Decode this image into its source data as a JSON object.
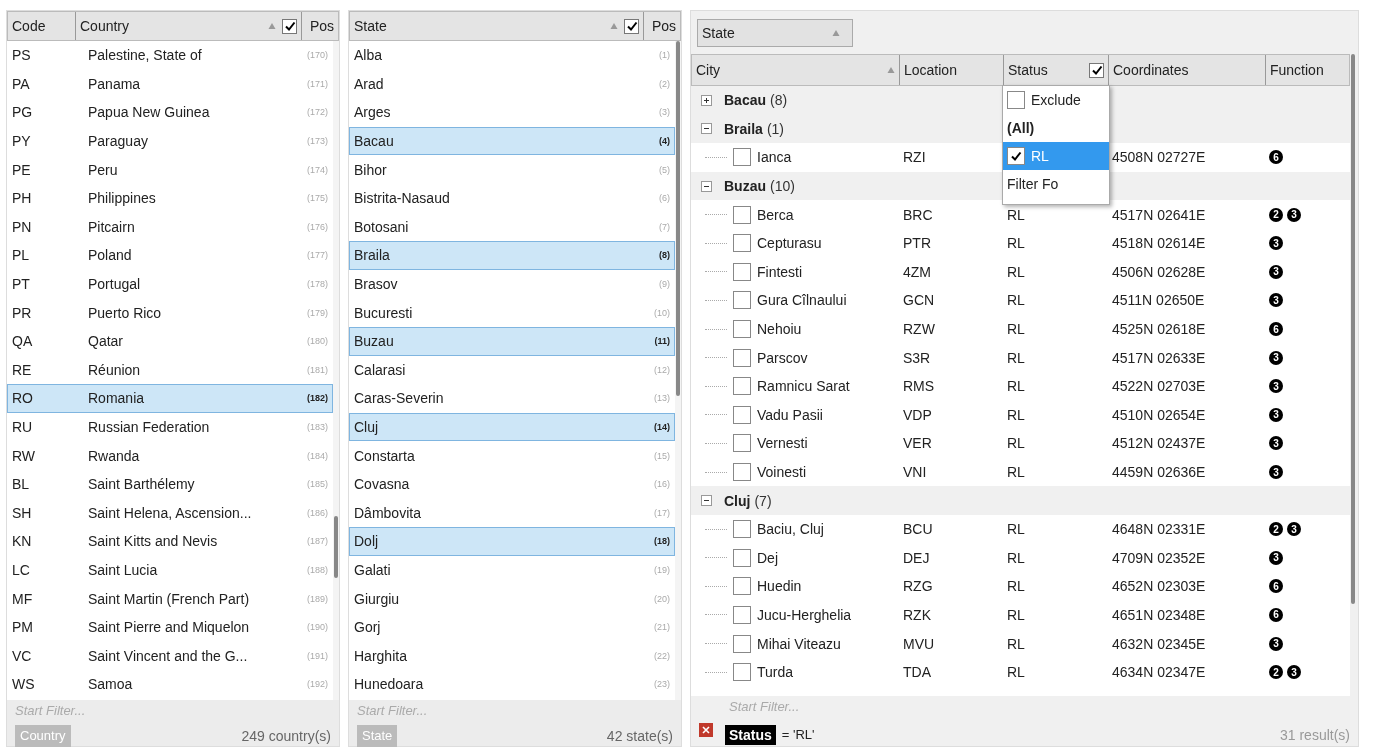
{
  "countries": {
    "columns": [
      "Code",
      "Country",
      "Pos"
    ],
    "header_checked": true,
    "rows": [
      {
        "code": "PS",
        "name": "Palestine, State of",
        "pos": "(170)",
        "selected": false
      },
      {
        "code": "PA",
        "name": "Panama",
        "pos": "(171)",
        "selected": false
      },
      {
        "code": "PG",
        "name": "Papua New Guinea",
        "pos": "(172)",
        "selected": false
      },
      {
        "code": "PY",
        "name": "Paraguay",
        "pos": "(173)",
        "selected": false
      },
      {
        "code": "PE",
        "name": "Peru",
        "pos": "(174)",
        "selected": false
      },
      {
        "code": "PH",
        "name": "Philippines",
        "pos": "(175)",
        "selected": false
      },
      {
        "code": "PN",
        "name": "Pitcairn",
        "pos": "(176)",
        "selected": false
      },
      {
        "code": "PL",
        "name": "Poland",
        "pos": "(177)",
        "selected": false
      },
      {
        "code": "PT",
        "name": "Portugal",
        "pos": "(178)",
        "selected": false
      },
      {
        "code": "PR",
        "name": "Puerto Rico",
        "pos": "(179)",
        "selected": false
      },
      {
        "code": "QA",
        "name": "Qatar",
        "pos": "(180)",
        "selected": false
      },
      {
        "code": "RE",
        "name": "Réunion",
        "pos": "(181)",
        "selected": false
      },
      {
        "code": "RO",
        "name": "Romania",
        "pos": "(182)",
        "selected": true
      },
      {
        "code": "RU",
        "name": "Russian Federation",
        "pos": "(183)",
        "selected": false
      },
      {
        "code": "RW",
        "name": "Rwanda",
        "pos": "(184)",
        "selected": false
      },
      {
        "code": "BL",
        "name": "Saint Barthélemy",
        "pos": "(185)",
        "selected": false
      },
      {
        "code": "SH",
        "name": "Saint Helena, Ascension...",
        "pos": "(186)",
        "selected": false
      },
      {
        "code": "KN",
        "name": "Saint Kitts and Nevis",
        "pos": "(187)",
        "selected": false
      },
      {
        "code": "LC",
        "name": "Saint Lucia",
        "pos": "(188)",
        "selected": false
      },
      {
        "code": "MF",
        "name": "Saint Martin (French Part)",
        "pos": "(189)",
        "selected": false
      },
      {
        "code": "PM",
        "name": "Saint Pierre and Miquelon",
        "pos": "(190)",
        "selected": false
      },
      {
        "code": "VC",
        "name": "Saint Vincent and the G...",
        "pos": "(191)",
        "selected": false
      },
      {
        "code": "WS",
        "name": "Samoa",
        "pos": "(192)",
        "selected": false
      }
    ],
    "filter_placeholder": "Start Filter...",
    "tag": "Country",
    "count": "249 country(s)"
  },
  "states": {
    "columns": [
      "State",
      "Pos"
    ],
    "header_checked": true,
    "rows": [
      {
        "name": "Alba",
        "pos": "(1)",
        "selected": false
      },
      {
        "name": "Arad",
        "pos": "(2)",
        "selected": false
      },
      {
        "name": "Arges",
        "pos": "(3)",
        "selected": false
      },
      {
        "name": "Bacau",
        "pos": "(4)",
        "selected": true
      },
      {
        "name": "Bihor",
        "pos": "(5)",
        "selected": false
      },
      {
        "name": "Bistrita-Nasaud",
        "pos": "(6)",
        "selected": false
      },
      {
        "name": "Botosani",
        "pos": "(7)",
        "selected": false
      },
      {
        "name": "Braila",
        "pos": "(8)",
        "selected": true
      },
      {
        "name": "Brasov",
        "pos": "(9)",
        "selected": false
      },
      {
        "name": "Bucuresti",
        "pos": "(10)",
        "selected": false
      },
      {
        "name": "Buzau",
        "pos": "(11)",
        "selected": true
      },
      {
        "name": "Calarasi",
        "pos": "(12)",
        "selected": false
      },
      {
        "name": "Caras-Severin",
        "pos": "(13)",
        "selected": false
      },
      {
        "name": "Cluj",
        "pos": "(14)",
        "selected": true
      },
      {
        "name": "Constarta",
        "pos": "(15)",
        "selected": false
      },
      {
        "name": "Covasna",
        "pos": "(16)",
        "selected": false
      },
      {
        "name": "Dâmbovita",
        "pos": "(17)",
        "selected": false
      },
      {
        "name": "Dolj",
        "pos": "(18)",
        "selected": true
      },
      {
        "name": "Galati",
        "pos": "(19)",
        "selected": false
      },
      {
        "name": "Giurgiu",
        "pos": "(20)",
        "selected": false
      },
      {
        "name": "Gorj",
        "pos": "(21)",
        "selected": false
      },
      {
        "name": "Harghita",
        "pos": "(22)",
        "selected": false
      },
      {
        "name": "Hunedoara",
        "pos": "(23)",
        "selected": false
      }
    ],
    "filter_placeholder": "Start Filter...",
    "tag": "State",
    "count": "42 state(s)"
  },
  "cities": {
    "group_by": "State",
    "columns": [
      "City",
      "Location",
      "Status",
      "Coordinates",
      "Function"
    ],
    "status_checked": true,
    "groups": [
      {
        "name": "Bacau",
        "count": "(8)",
        "expanded": false
      },
      {
        "name": "Braila",
        "count": "(1)",
        "expanded": true,
        "rows": [
          {
            "city": "Ianca",
            "location": "RZI",
            "coords": "4508N 02727E",
            "functions": [
              "6"
            ],
            "checked": false
          }
        ]
      },
      {
        "name": "Buzau",
        "count": "(10)",
        "expanded": true,
        "rows": [
          {
            "city": "Berca",
            "location": "BRC",
            "status": "RL",
            "coords": "4517N 02641E",
            "functions": [
              "2",
              "3"
            ],
            "checked": false
          },
          {
            "city": "Cepturasu",
            "location": "PTR",
            "status": "RL",
            "coords": "4518N 02614E",
            "functions": [
              "3"
            ],
            "checked": false
          },
          {
            "city": "Fintesti",
            "location": "4ZM",
            "status": "RL",
            "coords": "4506N 02628E",
            "functions": [
              "3"
            ],
            "checked": false
          },
          {
            "city": "Gura Cîlnaului",
            "location": "GCN",
            "status": "RL",
            "coords": "4511N 02650E",
            "functions": [
              "3"
            ],
            "checked": false
          },
          {
            "city": "Nehoiu",
            "location": "RZW",
            "status": "RL",
            "coords": "4525N 02618E",
            "functions": [
              "6"
            ],
            "checked": false
          },
          {
            "city": "Parscov",
            "location": "S3R",
            "status": "RL",
            "coords": "4517N 02633E",
            "functions": [
              "3"
            ],
            "checked": false
          },
          {
            "city": "Ramnicu Sarat",
            "location": "RMS",
            "status": "RL",
            "coords": "4522N 02703E",
            "functions": [
              "3"
            ],
            "checked": false
          },
          {
            "city": "Vadu Pasii",
            "location": "VDP",
            "status": "RL",
            "coords": "4510N 02654E",
            "functions": [
              "3"
            ],
            "checked": false
          },
          {
            "city": "Vernesti",
            "location": "VER",
            "status": "RL",
            "coords": "4512N 02437E",
            "functions": [
              "3"
            ],
            "checked": false
          },
          {
            "city": "Voinesti",
            "location": "VNI",
            "status": "RL",
            "coords": "4459N 02636E",
            "functions": [
              "3"
            ],
            "checked": false
          }
        ]
      },
      {
        "name": "Cluj",
        "count": "(7)",
        "expanded": true,
        "rows": [
          {
            "city": "Baciu, Cluj",
            "location": "BCU",
            "status": "RL",
            "coords": "4648N 02331E",
            "functions": [
              "2",
              "3"
            ],
            "checked": false
          },
          {
            "city": "Dej",
            "location": "DEJ",
            "status": "RL",
            "coords": "4709N 02352E",
            "functions": [
              "3"
            ],
            "checked": false
          },
          {
            "city": "Huedin",
            "location": "RZG",
            "status": "RL",
            "coords": "4652N 02303E",
            "functions": [
              "6"
            ],
            "checked": false
          },
          {
            "city": "Jucu-Herghelia",
            "location": "RZK",
            "status": "RL",
            "coords": "4651N 02348E",
            "functions": [
              "6"
            ],
            "checked": false
          },
          {
            "city": "Mihai Viteazu",
            "location": "MVU",
            "status": "RL",
            "coords": "4632N 02345E",
            "functions": [
              "3"
            ],
            "checked": false
          },
          {
            "city": "Turda",
            "location": "TDA",
            "status": "RL",
            "coords": "4634N 02347E",
            "functions": [
              "2",
              "3"
            ],
            "checked": false
          }
        ]
      }
    ],
    "dropdown": [
      {
        "kind": "checkbox",
        "label": "Exclude",
        "checked": false
      },
      {
        "kind": "header",
        "label": "(All)"
      },
      {
        "kind": "option",
        "label": "RL",
        "checked": true,
        "selected": true
      },
      {
        "kind": "text",
        "label": "Filter Fo"
      }
    ],
    "filter_placeholder": "Start Filter...",
    "filter_field": "Status",
    "filter_value": "= 'RL'",
    "result_count": "31 result(s)"
  }
}
